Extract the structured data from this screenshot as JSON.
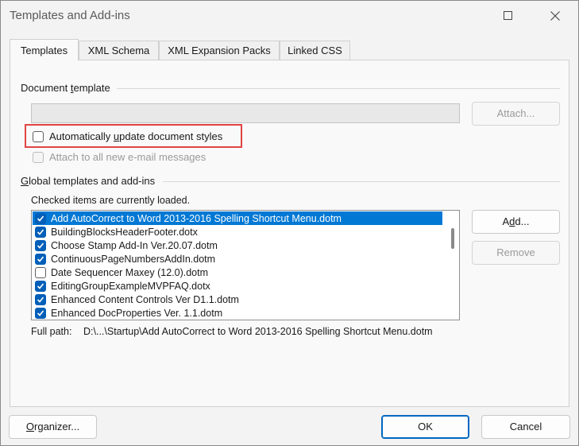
{
  "window": {
    "title": "Templates and Add-ins",
    "controls": [
      "maximize-icon",
      "close-icon"
    ]
  },
  "tabs": [
    {
      "label": "Templates",
      "active": true
    },
    {
      "label": "XML Schema",
      "active": false
    },
    {
      "label": "XML Expansion Packs",
      "active": false
    },
    {
      "label": "Linked CSS",
      "active": false
    }
  ],
  "document_template": {
    "group_label_prefix": "Document ",
    "group_label_u": "t",
    "group_label_suffix": "emplate",
    "path_value": "",
    "attach_label": "Attach...",
    "auto_update": {
      "label_prefix": "Automatically ",
      "label_u": "u",
      "label_suffix": "pdate document styles",
      "checked": false
    },
    "attach_email": {
      "label": "Attach to all new e-mail messages",
      "checked": false,
      "disabled": true
    }
  },
  "global": {
    "group_label_u": "G",
    "group_label_suffix": "lobal templates and add-ins",
    "hint": "Checked items are currently loaded.",
    "items": [
      {
        "label": "Add AutoCorrect to Word 2013-2016 Spelling Shortcut Menu.dotm",
        "checked": true,
        "selected": true
      },
      {
        "label": "BuildingBlocksHeaderFooter.dotx",
        "checked": true,
        "selected": false
      },
      {
        "label": "Choose Stamp Add-In Ver.20.07.dotm",
        "checked": true,
        "selected": false
      },
      {
        "label": "ContinuousPageNumbersAddIn.dotm",
        "checked": true,
        "selected": false
      },
      {
        "label": "Date Sequencer Maxey (12.0).dotm",
        "checked": false,
        "selected": false
      },
      {
        "label": "EditingGroupExampleMVPFAQ.dotx",
        "checked": true,
        "selected": false
      },
      {
        "label": "Enhanced Content Controls Ver D1.1.dotm",
        "checked": true,
        "selected": false
      },
      {
        "label": "Enhanced DocProperties Ver. 1.1.dotm",
        "checked": true,
        "selected": false
      }
    ],
    "add_label_prefix": "A",
    "add_label_u": "d",
    "add_label_suffix": "d...",
    "remove_label": "Remove",
    "fullpath_label": "Full path:",
    "fullpath_value": "D:\\...\\Startup\\Add AutoCorrect to Word 2013-2016 Spelling Shortcut Menu.dotm"
  },
  "footer": {
    "organizer_u": "O",
    "organizer_suffix": "rganizer...",
    "ok_label": "OK",
    "cancel_label": "Cancel"
  },
  "colors": {
    "accent": "#005fb8",
    "selection": "#0078d4",
    "highlight_box": "#e04444"
  }
}
